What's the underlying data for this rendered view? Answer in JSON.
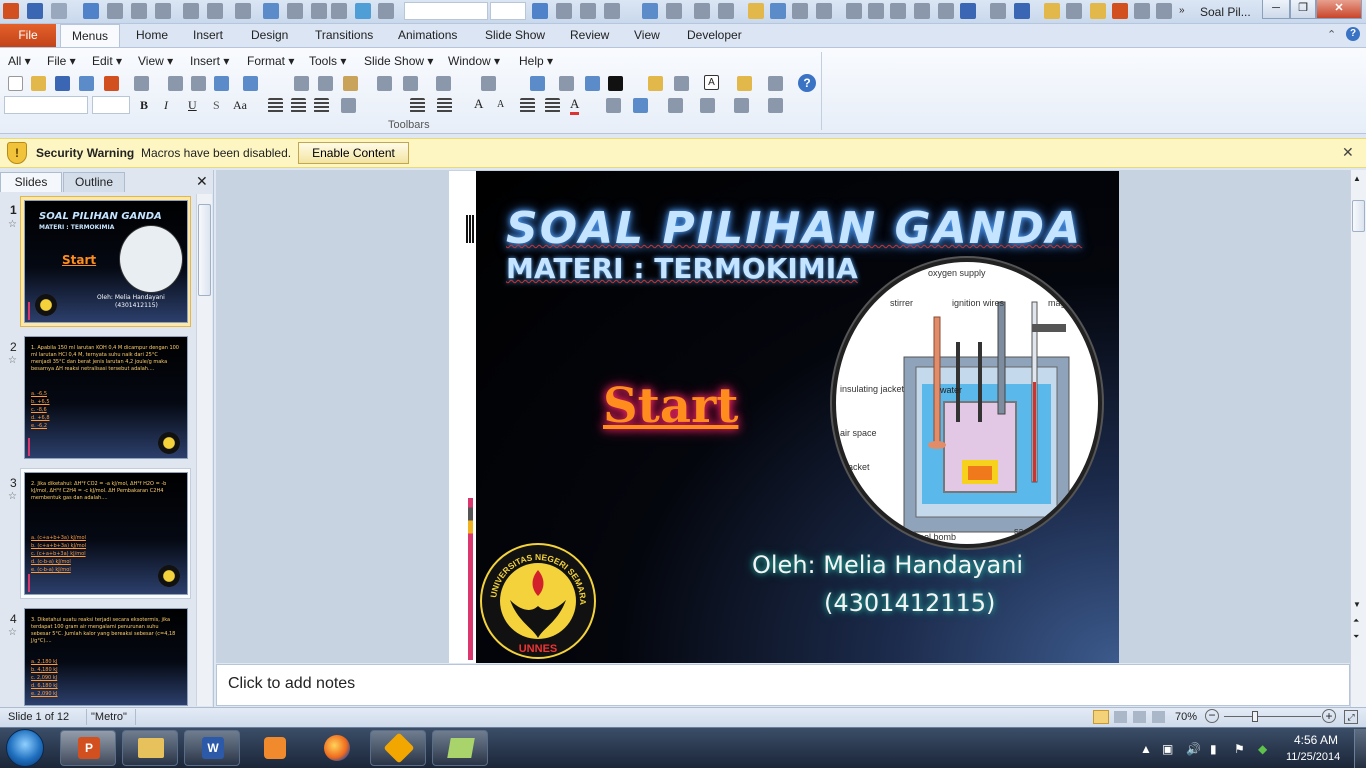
{
  "window": {
    "title": "Soal Pil...",
    "minimize": "─",
    "maximize": "❐",
    "close": "✕"
  },
  "tabs": [
    {
      "label": "File"
    },
    {
      "label": "Menus"
    },
    {
      "label": "Home"
    },
    {
      "label": "Insert"
    },
    {
      "label": "Design"
    },
    {
      "label": "Transitions"
    },
    {
      "label": "Animations"
    },
    {
      "label": "Slide Show"
    },
    {
      "label": "Review"
    },
    {
      "label": "View"
    },
    {
      "label": "Developer"
    }
  ],
  "menus": [
    {
      "label": "All ▾"
    },
    {
      "label": "File ▾"
    },
    {
      "label": "Edit ▾"
    },
    {
      "label": "View ▾"
    },
    {
      "label": "Insert ▾"
    },
    {
      "label": "Format ▾"
    },
    {
      "label": "Tools ▾"
    },
    {
      "label": "Slide Show ▾"
    },
    {
      "label": "Window ▾"
    },
    {
      "label": "Help ▾"
    }
  ],
  "toolbar_group_label": "Toolbars",
  "format_buttons": {
    "bold": "B",
    "italic": "I",
    "underline": "U",
    "shadow": "S",
    "font_case": "Aa"
  },
  "security": {
    "title": "Security Warning",
    "message": "Macros have been disabled.",
    "button": "Enable Content",
    "close": "✕"
  },
  "panel": {
    "tab_slides": "Slides",
    "tab_outline": "Outline",
    "close": "✕"
  },
  "thumbnails": [
    {
      "num": "1",
      "title": "SOAL PILIHAN GANDA",
      "subtitle": "MATERI : TERMOKIMIA",
      "start": "Start",
      "author": "Oleh: Melia Handayani",
      "nim": "(4301412115)"
    },
    {
      "num": "2",
      "question": "1. Apabila 150 ml larutan KOH 0,4 M dicampur dengan 100 ml larutan HCl 0,4 M, ternyata suhu naik dari 25°C menjadi 35°C dan berat jenis larutan 4,2 joule/g maka besarnya ΔH reaksi netralisasi tersebut adalah....",
      "options": [
        "a. -6,5",
        "b. +6,5",
        "c. -8,6",
        "d. +6,8",
        "e. -6,2"
      ]
    },
    {
      "num": "3",
      "question": "2. Jika diketahui: ΔH°f CO2 = -a kJ/mol, ΔH°f H2O = -b kJ/mol, ΔH°f C2H4 = -c kJ/mol. ΔH Pembakaran C2H4 membentuk gas dan adalah....",
      "options": [
        "a. (c+a+b+3a) kJ/mol",
        "b. (c+a+b+3a) kJ/mol",
        "c. (c+a+b+3a) kJ/mol",
        "d. (c-b-a) kJ/mol",
        "e. (c-b-a) kJ/mol"
      ]
    },
    {
      "num": "4",
      "question": "3. Diketahui suatu reaksi terjadi secara eksotermis, jika terdapat 100 gram air mengalami penurunan suhu sebesar 5°C. Jumlah kalor yang bereaksi sebesar (c=4,18 J/g°C)....",
      "options": [
        "a. 2,180 kJ",
        "b. 4,180 kJ",
        "c. 2,090 kJ",
        "d. 6,180 kJ",
        "e. 2,090 kJ"
      ]
    }
  ],
  "slide": {
    "title": "SOAL PILIHAN GANDA",
    "subtitle": "MATERI : TERMOKIMIA",
    "start": "Start",
    "author": "Oleh: Melia Handayani",
    "nim": "(4301412115)",
    "diagram_labels": {
      "oxygen": "oxygen supply",
      "stirrer": "stirrer",
      "ignition": "ignition wires",
      "eyepiece": "magn eyepi",
      "insulating": "insulating jacket",
      "water": "water",
      "air": "air space",
      "jacket": "jacket",
      "bomb": "steel bomb",
      "sample": "sa"
    },
    "logo_text": "UNIVERSITAS NEGERI SEMARANG",
    "logo_abbr": "UNNES"
  },
  "notes_placeholder": "Click to add notes",
  "status": {
    "slide_count": "Slide 1 of 12",
    "theme": "\"Metro\"",
    "zoom": "70%"
  },
  "taskbar": {
    "time": "4:56 AM",
    "date": "11/25/2014"
  },
  "colors": {
    "file_tab": "#d24f1f",
    "security_bar": "#fdf6c3",
    "title_glow": "#5aa9ff",
    "start_color": "#ff8d1e"
  }
}
